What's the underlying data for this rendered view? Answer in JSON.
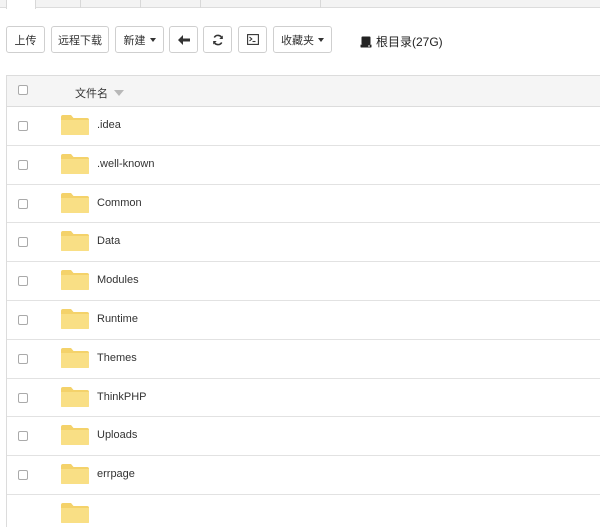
{
  "toolbar": {
    "upload_label": "上传",
    "remote_download_label": "远程下载",
    "new_label": "新建",
    "favorites_label": "收藏夹",
    "directory_label": "根目录(27G)"
  },
  "table": {
    "header": {
      "name_column": "文件名"
    },
    "rows": [
      {
        "name": ".idea",
        "type": "folder"
      },
      {
        "name": ".well-known",
        "type": "folder"
      },
      {
        "name": "Common",
        "type": "folder"
      },
      {
        "name": "Data",
        "type": "folder"
      },
      {
        "name": "Modules",
        "type": "folder"
      },
      {
        "name": "Runtime",
        "type": "folder"
      },
      {
        "name": "Themes",
        "type": "folder"
      },
      {
        "name": "ThinkPHP",
        "type": "folder"
      },
      {
        "name": "Uploads",
        "type": "folder"
      },
      {
        "name": "errpage",
        "type": "folder"
      }
    ]
  },
  "colors": {
    "folder_fill": "#f9df85",
    "folder_tab": "#f4d26a",
    "border": "#dcdcdc",
    "header_bg": "#f5f5f5"
  },
  "icons": {
    "back": "arrow-left-icon",
    "refresh": "refresh-icon",
    "terminal": "terminal-icon",
    "drive": "drive-icon",
    "folder": "folder-icon"
  }
}
